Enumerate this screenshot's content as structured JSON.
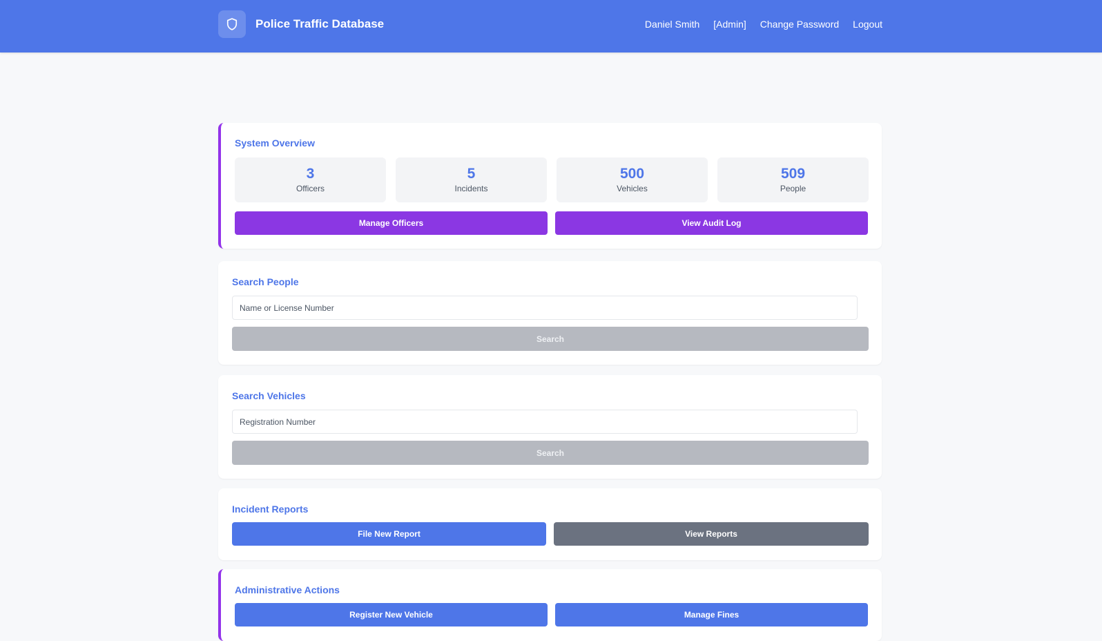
{
  "header": {
    "title": "Police Traffic Database",
    "user_name": "Daniel Smith",
    "role": "[Admin]",
    "change_password": "Change Password",
    "logout": "Logout"
  },
  "overview": {
    "title": "System Overview",
    "stats": [
      {
        "value": "3",
        "label": "Officers"
      },
      {
        "value": "5",
        "label": "Incidents"
      },
      {
        "value": "500",
        "label": "Vehicles"
      },
      {
        "value": "509",
        "label": "People"
      }
    ],
    "manage_officers": "Manage Officers",
    "view_audit_log": "View Audit Log"
  },
  "search_people": {
    "title": "Search People",
    "placeholder": "Name or License Number",
    "button": "Search"
  },
  "search_vehicles": {
    "title": "Search Vehicles",
    "placeholder": "Registration Number",
    "button": "Search"
  },
  "incidents": {
    "title": "Incident Reports",
    "file_new": "File New Report",
    "view_reports": "View Reports"
  },
  "admin_actions": {
    "title": "Administrative Actions",
    "register_vehicle": "Register New Vehicle",
    "manage_fines": "Manage Fines"
  },
  "colors": {
    "primary": "#4e76e8",
    "purple": "#8b37e3",
    "gray": "#6b7280",
    "disabled": "#b6b9c0"
  },
  "icons": {
    "logo": "shield-icon"
  }
}
